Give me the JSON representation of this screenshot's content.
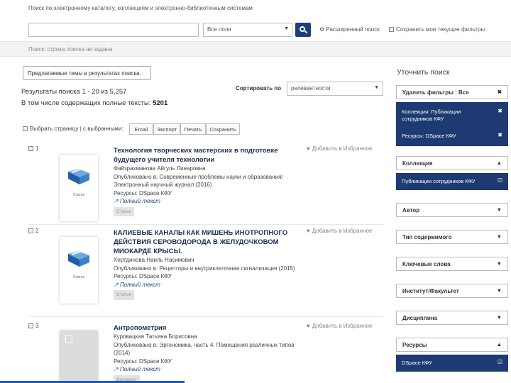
{
  "search": {
    "title": "Поиск по электронному каталогу, коллекциям и электронно-библиотечным системам",
    "query_value": "",
    "scope_value": "Все поля",
    "advanced_label": "Расширенный поиск",
    "keep_filters_label": "Сохранить мои текущие фильтры",
    "status_bar": "Поиск: строка поиска не задана",
    "suggest_button": "Предлагаемые темы в результатах поиска."
  },
  "results": {
    "count_text": "Результаты поиска 1 - 20 из 5,257",
    "fulltext_label": "В том числе содержащих полные тексты:",
    "fulltext_value": "5201",
    "sort_label": "Сортировать по",
    "sort_value": "релевантности",
    "select_page_label": "Выбрать страницу | с выбранными:",
    "toolbar_buttons": [
      "Email",
      "Экспорт",
      "Печать",
      "Сохранить"
    ],
    "favorite_label": "Добавить в Избранное",
    "items": [
      {
        "num": "1",
        "title": "Технология творческих мастерских в подготовке будущего учителя технологии",
        "author": "Файзрахманова Айгуль Линаровна",
        "published": "Опубликовано в: Современные проблемы науки и образования/Электронный научный журнал (2016)",
        "resource": "Ресурсы: DSpace КФУ",
        "fulltext_link": "Полный текст",
        "tag": "Статья",
        "thumb_label": "Статья"
      },
      {
        "num": "2",
        "title": "КАЛИЕВЫЕ КАНАЛЫ КАК МИШЕНЬ ИНОТРОПНОГО ДЕЙСТВИЯ СЕРОВОДОРОДА В ЖЕЛУДОЧКОВОМ МИОКАРДЕ КРЫСЫ.",
        "author": "Хертдинова Наиль Насимович",
        "published": "Опубликовано в: Рецепторы и внутриклеточная сигнализация (2015)",
        "resource": "Ресурсы: DSpace КФУ",
        "fulltext_link": "Полный текст",
        "tag": "Статья",
        "thumb_label": "Статья"
      },
      {
        "num": "3",
        "title": "Антропометрия",
        "author": "Куровацкая Татьяна Борисовна",
        "published": "Опубликовано в: Эргономика, часть 4. Помещения различных типов (2014)",
        "resource": "Ресурсы: DSpace КФУ",
        "fulltext_link": "Полный текст",
        "tag": "Документ",
        "thumb_label": ""
      }
    ]
  },
  "sidebar": {
    "heading": "Уточнить поиск",
    "remove_filters": "Удалить фильтры : Все",
    "active_filters": [
      "Коллекция: Публикации сотрудников КФУ",
      "Ресурсы: DSpace КФУ"
    ],
    "facets": {
      "collection": "Коллекция",
      "collection_value": "Публикации сотрудников КФУ",
      "author": "Автор",
      "content_type": "Тип содержимого",
      "keywords": "Ключевые слова",
      "institute": "Институт/Факультет",
      "discipline": "Дисциплина",
      "resources": "Ресурсы",
      "resources_value": "DSpace КФУ"
    }
  },
  "icons": {
    "close": "close-icon",
    "collapse": "chevron-up-icon",
    "expand": "chevron-down-icon",
    "checked": "checkbox-checked-icon",
    "search": "search-icon",
    "gear": "gear-icon",
    "heart": "heart-icon",
    "external": "external-link-icon"
  },
  "colors": {
    "primary": "#1d3a72",
    "link": "#1e3f7e",
    "accent_bar": "#1d5ab0"
  }
}
